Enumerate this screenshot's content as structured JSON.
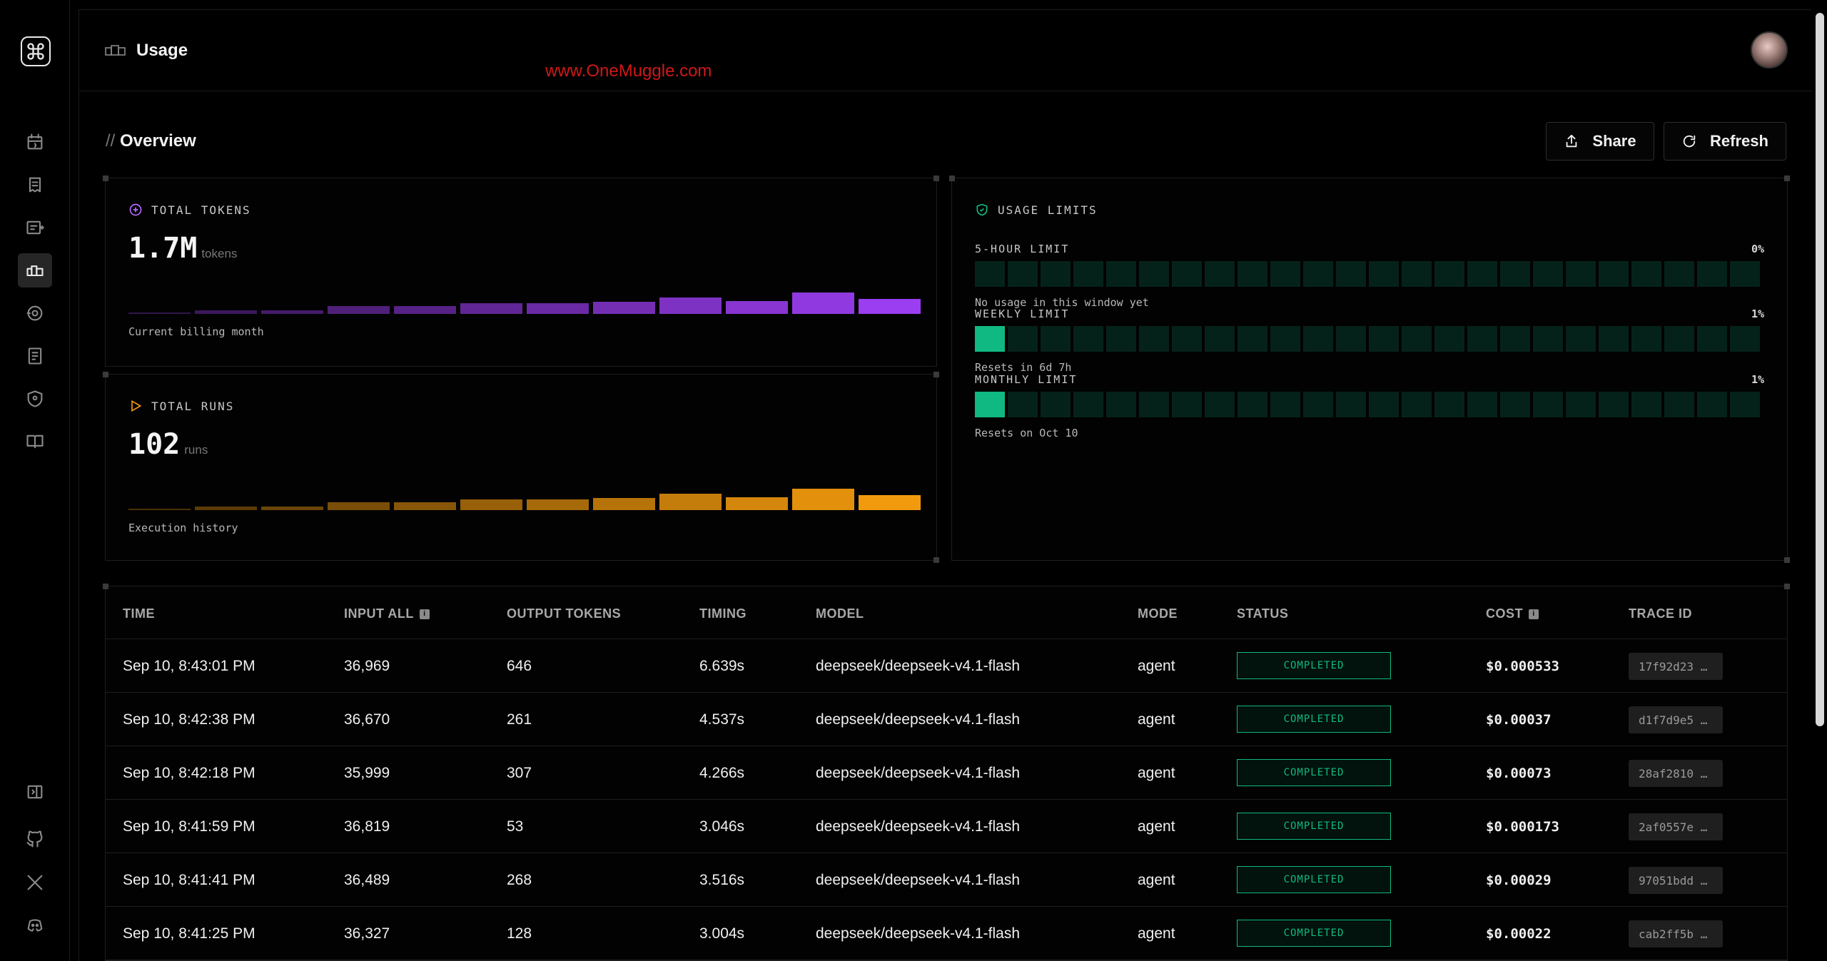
{
  "header": {
    "title": "Usage",
    "watermark": "www.OneMuggle.com"
  },
  "overview": {
    "title": "Overview",
    "title_prefix": "//",
    "share_label": "Share",
    "refresh_label": "Refresh"
  },
  "tokens_card": {
    "label": "TOTAL TOKENS",
    "value": "1.7M",
    "unit": "tokens",
    "caption": "Current billing month"
  },
  "runs_card": {
    "label": "TOTAL RUNS",
    "value": "102",
    "unit": "runs",
    "caption": "Execution history"
  },
  "limits": {
    "label": "USAGE LIMITS",
    "segment_count": 24,
    "items": [
      {
        "name": "5-HOUR LIMIT",
        "percent": "0%",
        "note": "No usage in this window yet",
        "filled_segments": 0
      },
      {
        "name": "WEEKLY LIMIT",
        "percent": "1%",
        "note": "Resets in 6d 7h",
        "filled_segments": 1
      },
      {
        "name": "MONTHLY LIMIT",
        "percent": "1%",
        "note": "Resets on Oct 10",
        "filled_segments": 1
      }
    ]
  },
  "table": {
    "headers": [
      "TIME",
      "INPUT ALL",
      "OUTPUT TOKENS",
      "TIMING",
      "MODEL",
      "MODE",
      "STATUS",
      "COST",
      "TRACE ID"
    ],
    "rows": [
      {
        "time": "Sep 10, 8:43:01 PM",
        "input": "36,969",
        "output": "646",
        "timing": "6.639s",
        "model": "deepseek/deepseek-v4.1-flash",
        "mode": "agent",
        "status": "COMPLETED",
        "cost": "$0.000533",
        "trace": "17f92d23 …"
      },
      {
        "time": "Sep 10, 8:42:38 PM",
        "input": "36,670",
        "output": "261",
        "timing": "4.537s",
        "model": "deepseek/deepseek-v4.1-flash",
        "mode": "agent",
        "status": "COMPLETED",
        "cost": "$0.00037",
        "trace": "d1f7d9e5 …"
      },
      {
        "time": "Sep 10, 8:42:18 PM",
        "input": "35,999",
        "output": "307",
        "timing": "4.266s",
        "model": "deepseek/deepseek-v4.1-flash",
        "mode": "agent",
        "status": "COMPLETED",
        "cost": "$0.00073",
        "trace": "28af2810 …"
      },
      {
        "time": "Sep 10, 8:41:59 PM",
        "input": "36,819",
        "output": "53",
        "timing": "3.046s",
        "model": "deepseek/deepseek-v4.1-flash",
        "mode": "agent",
        "status": "COMPLETED",
        "cost": "$0.000173",
        "trace": "2af0557e …"
      },
      {
        "time": "Sep 10, 8:41:41 PM",
        "input": "36,489",
        "output": "268",
        "timing": "3.516s",
        "model": "deepseek/deepseek-v4.1-flash",
        "mode": "agent",
        "status": "COMPLETED",
        "cost": "$0.00029",
        "trace": "97051bdd …"
      },
      {
        "time": "Sep 10, 8:41:25 PM",
        "input": "36,327",
        "output": "128",
        "timing": "3.004s",
        "model": "deepseek/deepseek-v4.1-flash",
        "mode": "agent",
        "status": "COMPLETED",
        "cost": "$0.00022",
        "trace": "cab2ff5b …"
      }
    ]
  },
  "sidebar": {
    "icons": [
      "calendar-icon",
      "receipt-icon",
      "magic-card-icon",
      "usage-icon",
      "target-icon",
      "invoice-icon",
      "shield-icon",
      "book-icon",
      "collapse-icon",
      "github-icon",
      "x-icon",
      "discord-icon"
    ]
  },
  "colors": {
    "accent_purple": "#9b3df0",
    "accent_orange": "#f29a0e",
    "limit_green": "#10b981"
  }
}
